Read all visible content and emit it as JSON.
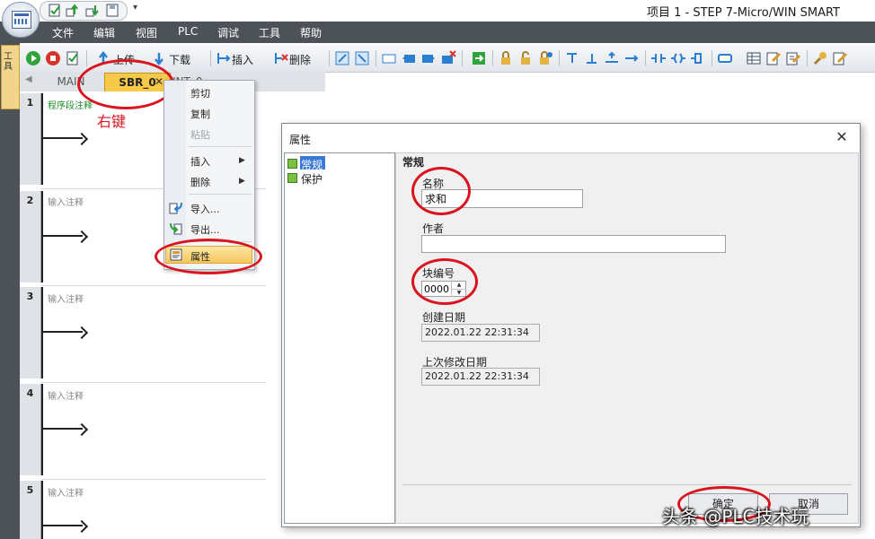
{
  "window": {
    "title": "项目 1 - STEP 7-Micro/WIN SMART",
    "qat_dropdown": "▾"
  },
  "menu": {
    "items": [
      "文件",
      "编辑",
      "视图",
      "PLC",
      "调试",
      "工具",
      "帮助"
    ]
  },
  "toolbar": {
    "upload_label": "上传",
    "download_label": "下载",
    "insert_label": "插入",
    "delete_label": "删除"
  },
  "side_panel": {
    "label": "工具"
  },
  "tabs": {
    "main": "MAIN",
    "sbr": "SBR_0",
    "close": "✕",
    "int": "INT_0"
  },
  "networks": [
    {
      "number": "1",
      "comment": "程序段注释"
    },
    {
      "number": "2",
      "comment": "输入注释"
    },
    {
      "number": "3",
      "comment": "输入注释"
    },
    {
      "number": "4",
      "comment": "输入注释"
    },
    {
      "number": "5",
      "comment": "输入注释"
    }
  ],
  "annotation": {
    "right_click": "右键"
  },
  "context_menu": {
    "cut": "剪切",
    "copy": "复制",
    "paste": "粘贴",
    "insert": "插入",
    "delete": "删除",
    "import": "导入...",
    "export": "导出...",
    "properties": "属性",
    "submenu_arrow": "▶"
  },
  "dialog": {
    "title": "属性",
    "close": "✕",
    "tree": [
      "常规",
      "保护"
    ],
    "section": "常规",
    "name_label": "名称",
    "name_value": "求和",
    "author_label": "作者",
    "author_value": "",
    "block_label": "块编号",
    "block_value": "0000",
    "created_label": "创建日期",
    "created_value": "2022.01.22    22:31:34",
    "modified_label": "上次修改日期",
    "modified_value": "2022.01.22    22:31:34",
    "ok": "确定",
    "cancel": "取消"
  },
  "watermark": "头条 @PLC技术玩",
  "colors": {
    "menu_bg": "#4d5259",
    "tab_active": "#f7c948",
    "annotation_red": "#d9141f",
    "selection": "#3a79d8"
  }
}
